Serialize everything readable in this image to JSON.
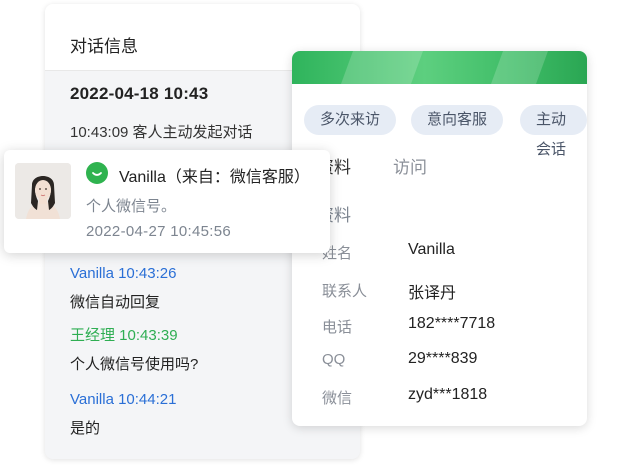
{
  "conversation": {
    "title": "对话信息",
    "date": "2022-04-18  10:43",
    "event": "10:43:09 客人主动发起对话",
    "messages": [
      {
        "sender": "Vanilla 10:43:26",
        "text": "微信自动回复",
        "color": "#2a6fd6"
      },
      {
        "sender": "王经理 10:43:39",
        "text": "个人微信号使用吗?",
        "color": "#2fae53"
      },
      {
        "sender": "Vanilla 10:44:21",
        "text": "是的",
        "color": "#2a6fd6"
      }
    ]
  },
  "customer": {
    "tags": [
      "多次来访",
      "意向客服",
      "主动会话"
    ],
    "tabs": [
      "资料",
      "访问"
    ],
    "section_title": "资料",
    "fields": [
      {
        "label": "姓名",
        "value": "Vanilla"
      },
      {
        "label": "联系人",
        "value": "张译丹"
      },
      {
        "label": "电话",
        "value": "182****7718"
      },
      {
        "label": "QQ",
        "value": "29****839"
      },
      {
        "label": "微信",
        "value": "zyd***1818"
      }
    ]
  },
  "notification": {
    "name": "Vanilla（来自：微信客服）",
    "message": "个人微信号。",
    "time": "2022-04-27  10:45:56",
    "icon": "wechat-icon"
  },
  "colors": {
    "accent_green": "#2fb34f",
    "link_blue": "#2a6fd6",
    "agent_green": "#2fae53",
    "tag_bg": "#e6ecf5"
  }
}
